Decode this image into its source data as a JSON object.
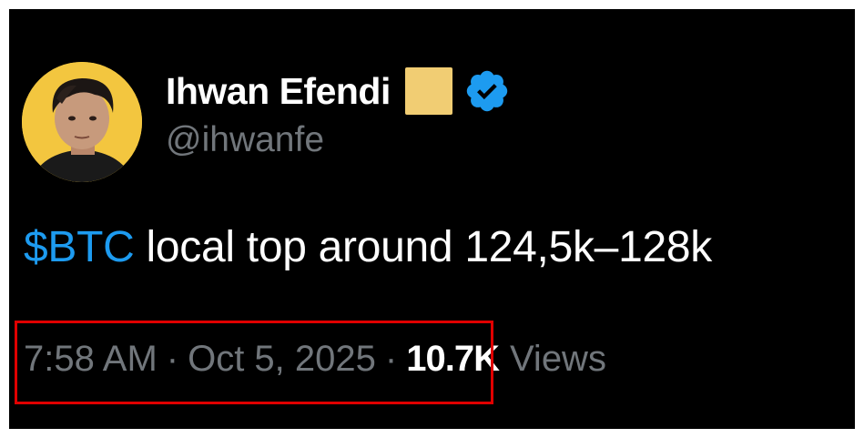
{
  "author": {
    "display_name": "Ihwan Efendi",
    "handle": "@ihwanfe",
    "avatar_icon": "profile-photo",
    "badge_color": "#f1cd73",
    "verified_icon": "verified-badge-icon",
    "verified_color": "#1d9bf0"
  },
  "tweet": {
    "cashtag": "$BTC",
    "text": " local top around 124,5k–128k"
  },
  "meta": {
    "time": "7:58 AM",
    "separator": "·",
    "date": "Oct 5, 2025",
    "views_count": "10.7K",
    "views_label": "Views"
  },
  "highlight": {
    "color": "#e00000"
  }
}
